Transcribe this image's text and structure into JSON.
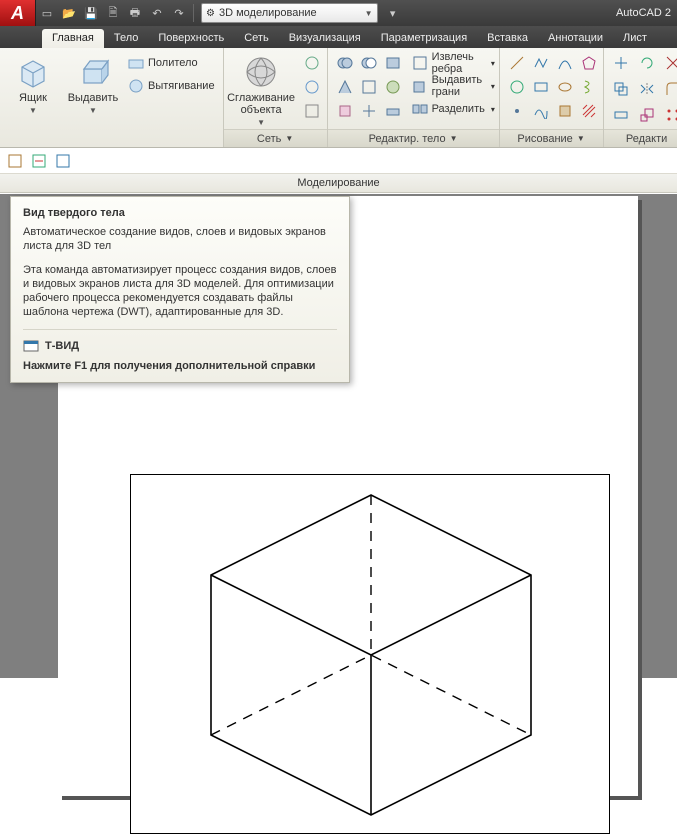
{
  "app": {
    "title": "AutoCAD 2"
  },
  "workspace": {
    "label": "3D моделирование"
  },
  "tabs": {
    "items": [
      {
        "label": "Главная",
        "active": true
      },
      {
        "label": "Тело"
      },
      {
        "label": "Поверхность"
      },
      {
        "label": "Сеть"
      },
      {
        "label": "Визуализация"
      },
      {
        "label": "Параметризация"
      },
      {
        "label": "Вставка"
      },
      {
        "label": "Аннотации"
      },
      {
        "label": "Лист"
      }
    ]
  },
  "ribbon": {
    "modeling": {
      "box": "Ящик",
      "extrude": "Выдавить",
      "polysolid": "Политело",
      "presspull": "Вытягивание",
      "title": "Моделирование"
    },
    "mesh": {
      "smooth_line1": "Сглаживание",
      "smooth_line2": "объекта",
      "title": "Сеть"
    },
    "solidedit": {
      "extract_edges": "Извлечь ребра",
      "extrude_faces": "Выдавить грани",
      "separate": "Разделить",
      "title": "Редактир. тело"
    },
    "draw": {
      "title": "Рисование"
    },
    "modify": {
      "title": "Редакти"
    }
  },
  "subpanel": {
    "title": "Моделирование"
  },
  "tooltip": {
    "title": "Вид твердого тела",
    "p1": "Автоматическое создание видов, слоев и видовых экранов листа для 3D тел",
    "p2": "Эта команда автоматизирует процесс создания видов, слоев и видовых экранов листа для 3D моделей. Для оптимизации рабочего процесса рекомендуется создавать файлы шаблона чертежа (DWT), адаптированные для 3D.",
    "cmd": "Т-ВИД",
    "f1": "Нажмите F1 для получения дополнительной справки"
  }
}
